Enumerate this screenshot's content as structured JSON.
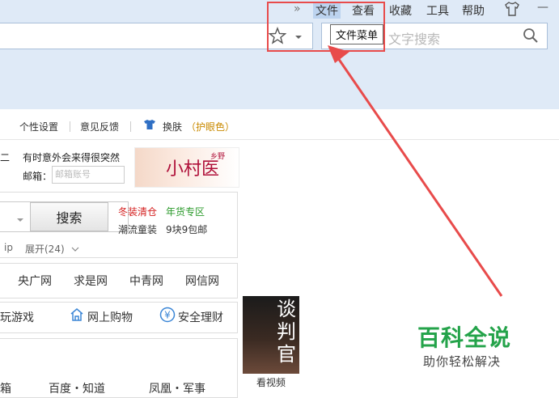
{
  "menubar": {
    "chevron": "»",
    "items": [
      "文件",
      "查看",
      "收藏",
      "工具",
      "帮助"
    ],
    "minimize": "—"
  },
  "search": {
    "placeholder_visible": "文字搜索",
    "tooltip": "文件菜单"
  },
  "linkbar": {
    "items": [
      "个性设置",
      "意见反馈"
    ],
    "skin": "换肤",
    "eye_mode": "（护眼色）"
  },
  "content": {
    "notice_line1": "有时意外会来得很突然",
    "notice_prefix": "二",
    "mail_label": "邮箱：",
    "mail_placeholder": "邮箱账号",
    "ad_small": "乡野",
    "ad_title": "小村医",
    "search_button": "搜索",
    "promo": [
      "冬装清仓",
      "年货专区",
      "潮流童装",
      "9块9包邮"
    ],
    "ip_text": "ip",
    "expand_text": "展开(24)",
    "sites": [
      "央广网",
      "求是网",
      "中青网",
      "网信网"
    ],
    "categories": [
      "玩游戏",
      "网上购物",
      "安全理财"
    ],
    "bottom_links": [
      "箱",
      "百度・知道",
      "凤凰・军事"
    ],
    "portrait_text": "谈判官",
    "watch_label": "看视频"
  },
  "watermark": {
    "main": "百科全说",
    "sub": "助你轻松解决"
  },
  "colors": {
    "accent_red": "#e84b4b",
    "brand_green": "#24a34a",
    "chrome_blue": "#dfeaf7"
  }
}
